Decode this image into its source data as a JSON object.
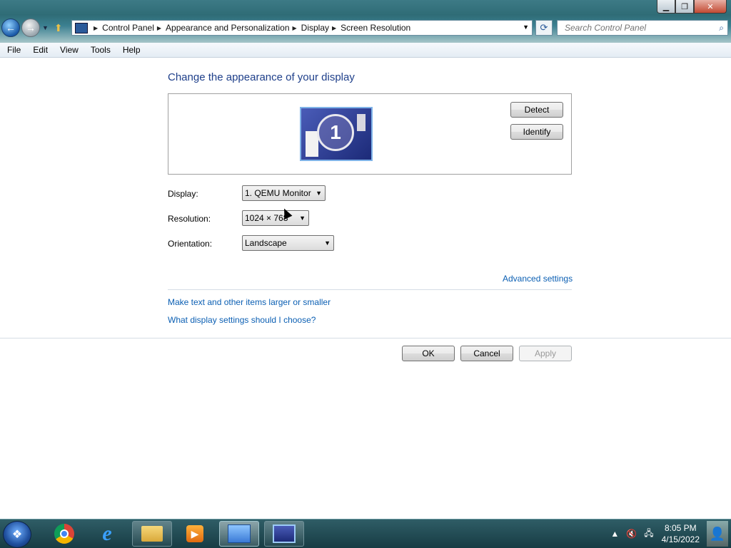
{
  "breadcrumb": [
    "Control Panel",
    "Appearance and Personalization",
    "Display",
    "Screen Resolution"
  ],
  "search": {
    "placeholder": "Search Control Panel"
  },
  "window_buttons": {
    "minimize": "▁",
    "maximize": "❐",
    "close": "✕"
  },
  "menubar": [
    "File",
    "Edit",
    "View",
    "Tools",
    "Help"
  ],
  "main": {
    "heading": "Change the appearance of your display",
    "monitor_number": "1",
    "detect_label": "Detect",
    "identify_label": "Identify",
    "display_label": "Display:",
    "display_value": "1. QEMU Monitor",
    "resolution_label": "Resolution:",
    "resolution_value": "1024 × 768",
    "orientation_label": "Orientation:",
    "orientation_value": "Landscape",
    "advanced_link": "Advanced settings",
    "link_text_size": "Make text and other items larger or smaller",
    "link_which_settings": "What display settings should I choose?",
    "ok_label": "OK",
    "cancel_label": "Cancel",
    "apply_label": "Apply"
  },
  "taskbar": {
    "time": "8:05 PM",
    "date": "4/15/2022",
    "icons": [
      "start-orb-icon",
      "chrome-icon",
      "internet-explorer-icon",
      "file-explorer-icon",
      "media-player-icon",
      "control-panel-icon",
      "display-settings-icon"
    ]
  }
}
